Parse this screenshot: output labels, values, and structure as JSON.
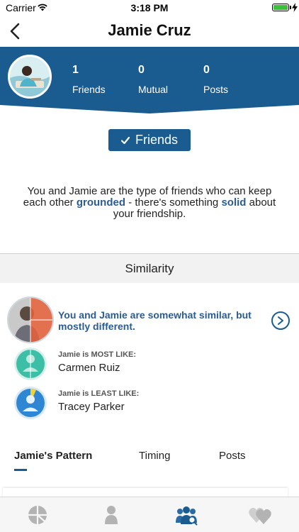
{
  "status_bar": {
    "carrier": "Carrier",
    "time": "3:18 PM",
    "battery_level": 1.0
  },
  "nav": {
    "title": "Jamie Cruz",
    "back_icon": "chevron-left-icon"
  },
  "profile": {
    "stats": [
      {
        "value": "1",
        "label": "Friends"
      },
      {
        "value": "0",
        "label": "Mutual"
      },
      {
        "value": "0",
        "label": "Posts"
      }
    ]
  },
  "friends_button": {
    "label": "Friends",
    "icon": "checkmark-icon"
  },
  "description": {
    "part1": "You and Jamie are the type of friends who can keep each other ",
    "highlight1": "grounded",
    "part2": " - there's something ",
    "highlight2": "solid",
    "part3": " about your friendship."
  },
  "similarity": {
    "header": "Similarity",
    "summary": "You and Jamie are somewhat similar, but mostly different.",
    "most_like": {
      "label": "Jamie is MOST LIKE:",
      "name": "Carmen Ruiz"
    },
    "least_like": {
      "label": "Jamie is LEAST LIKE:",
      "name": "Tracey Parker"
    }
  },
  "tabs": [
    {
      "label": "Jamie's Pattern",
      "active": true
    },
    {
      "label": "Timing",
      "active": false
    },
    {
      "label": "Posts",
      "active": false
    }
  ],
  "tab_bar": {
    "items": [
      "pattern-icon",
      "profile-icon",
      "friends-search-icon",
      "hearts-icon"
    ],
    "active_index": 2
  },
  "colors": {
    "brand_blue": "#1a5c8f",
    "highlight_text": "#2a5c93",
    "similarity_orange": "#e8623a",
    "most_like_teal": "#3cbfa6",
    "least_like_blue": "#2f86d2"
  }
}
